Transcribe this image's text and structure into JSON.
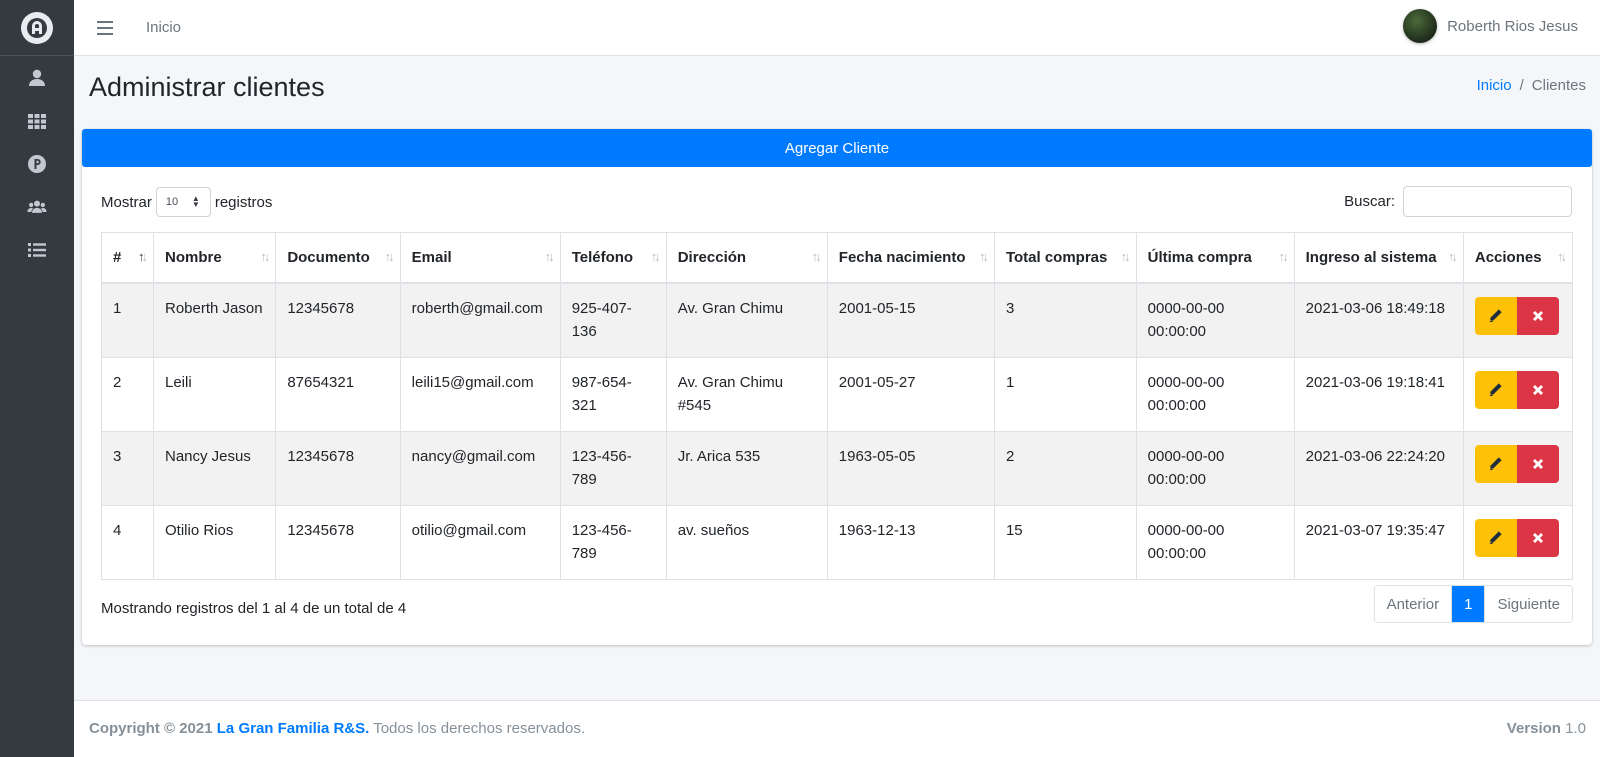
{
  "sidebar": {
    "brand_icon": "app-logo-icon",
    "items": [
      {
        "icon": "user-icon"
      },
      {
        "icon": "grid-icon"
      },
      {
        "icon": "product-icon"
      },
      {
        "icon": "users-icon"
      },
      {
        "icon": "list-icon"
      }
    ]
  },
  "topbar": {
    "home_label": "Inicio",
    "user_name": "Roberth Rios Jesus"
  },
  "header": {
    "title": "Administrar clientes",
    "breadcrumb": {
      "home": "Inicio",
      "current": "Clientes"
    }
  },
  "toolbar": {
    "add_label": "Agregar Cliente",
    "show_label": "Mostrar",
    "show_value": "10",
    "records_label": "registros",
    "search_label": "Buscar:"
  },
  "table": {
    "columns": [
      "#",
      "Nombre",
      "Documento",
      "Email",
      "Teléfono",
      "Dirección",
      "Fecha nacimiento",
      "Total compras",
      "Última compra",
      "Ingreso al sistema",
      "Acciones"
    ],
    "rows": [
      [
        "1",
        "Roberth Jason",
        "12345678",
        "roberth@gmail.com",
        "925-407-136",
        "Av. Gran Chimu",
        "2001-05-15",
        "3",
        "0000-00-00 00:00:00",
        "2021-03-06 18:49:18"
      ],
      [
        "2",
        "Leili",
        "87654321",
        "leili15@gmail.com",
        "987-654-321",
        "Av. Gran Chimu #545",
        "2001-05-27",
        "1",
        "0000-00-00 00:00:00",
        "2021-03-06 19:18:41"
      ],
      [
        "3",
        "Nancy Jesus",
        "12345678",
        "nancy@gmail.com",
        "123-456-789",
        "Jr. Arica 535",
        "1963-05-05",
        "2",
        "0000-00-00 00:00:00",
        "2021-03-06 22:24:20"
      ],
      [
        "4",
        "Otilio Rios",
        "12345678",
        "otilio@gmail.com",
        "123-456-789",
        "av. sueños",
        "1963-12-13",
        "15",
        "0000-00-00 00:00:00",
        "2021-03-07 19:35:47"
      ]
    ]
  },
  "pagination": {
    "info": "Mostrando registros del 1 al 4 de un total de 4",
    "prev": "Anterior",
    "current": "1",
    "next": "Siguiente"
  },
  "footer": {
    "copyright": "Copyright © 2021",
    "org": "La Gran Familia R&S.",
    "rights": "Todos los derechos reservados.",
    "version_label": "Version",
    "version": "1.0"
  },
  "colors": {
    "primary": "#007bff",
    "warning": "#ffc107",
    "danger": "#dc3545",
    "sidebar": "#343a40"
  }
}
